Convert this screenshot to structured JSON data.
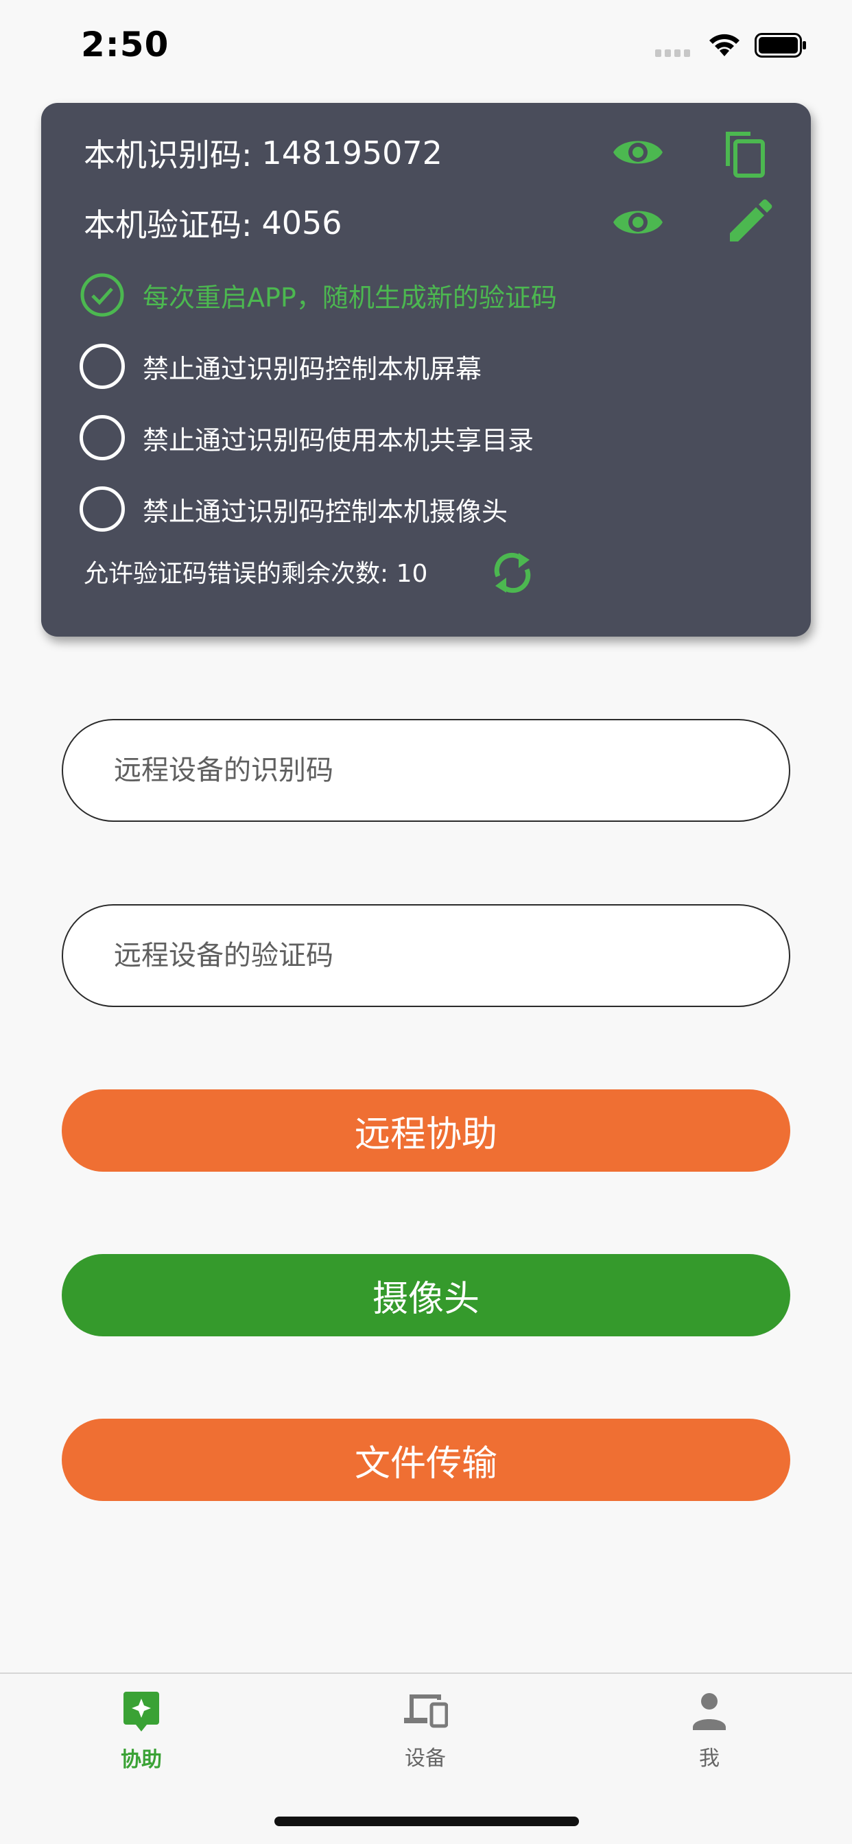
{
  "status_bar": {
    "time": "2:50"
  },
  "card": {
    "device_id_label": "本机识别码:",
    "device_id_value": "148195072",
    "verify_code_label": "本机验证码:",
    "verify_code_value": "4056",
    "options": [
      {
        "label": "每次重启APP，随机生成新的验证码",
        "checked": true
      },
      {
        "label": "禁止通过识别码控制本机屏幕",
        "checked": false
      },
      {
        "label": "禁止通过识别码使用本机共享目录",
        "checked": false
      },
      {
        "label": "禁止通过识别码控制本机摄像头",
        "checked": false
      }
    ],
    "attempts_label": "允许验证码错误的剩余次数: 10"
  },
  "form": {
    "remote_id_placeholder": "远程设备的识别码",
    "remote_code_placeholder": "远程设备的验证码"
  },
  "buttons": {
    "remote_assist": "远程协助",
    "camera": "摄像头",
    "file_transfer": "文件传输"
  },
  "tabs": [
    {
      "label": "协助",
      "icon": "assist-icon",
      "active": true
    },
    {
      "label": "设备",
      "icon": "devices-icon",
      "active": false
    },
    {
      "label": "我",
      "icon": "person-icon",
      "active": false
    }
  ],
  "colors": {
    "accent_green": "#4cb850",
    "card_bg": "#4a4d5b",
    "orange": "#ef6f33",
    "green_button": "#359a2c"
  }
}
